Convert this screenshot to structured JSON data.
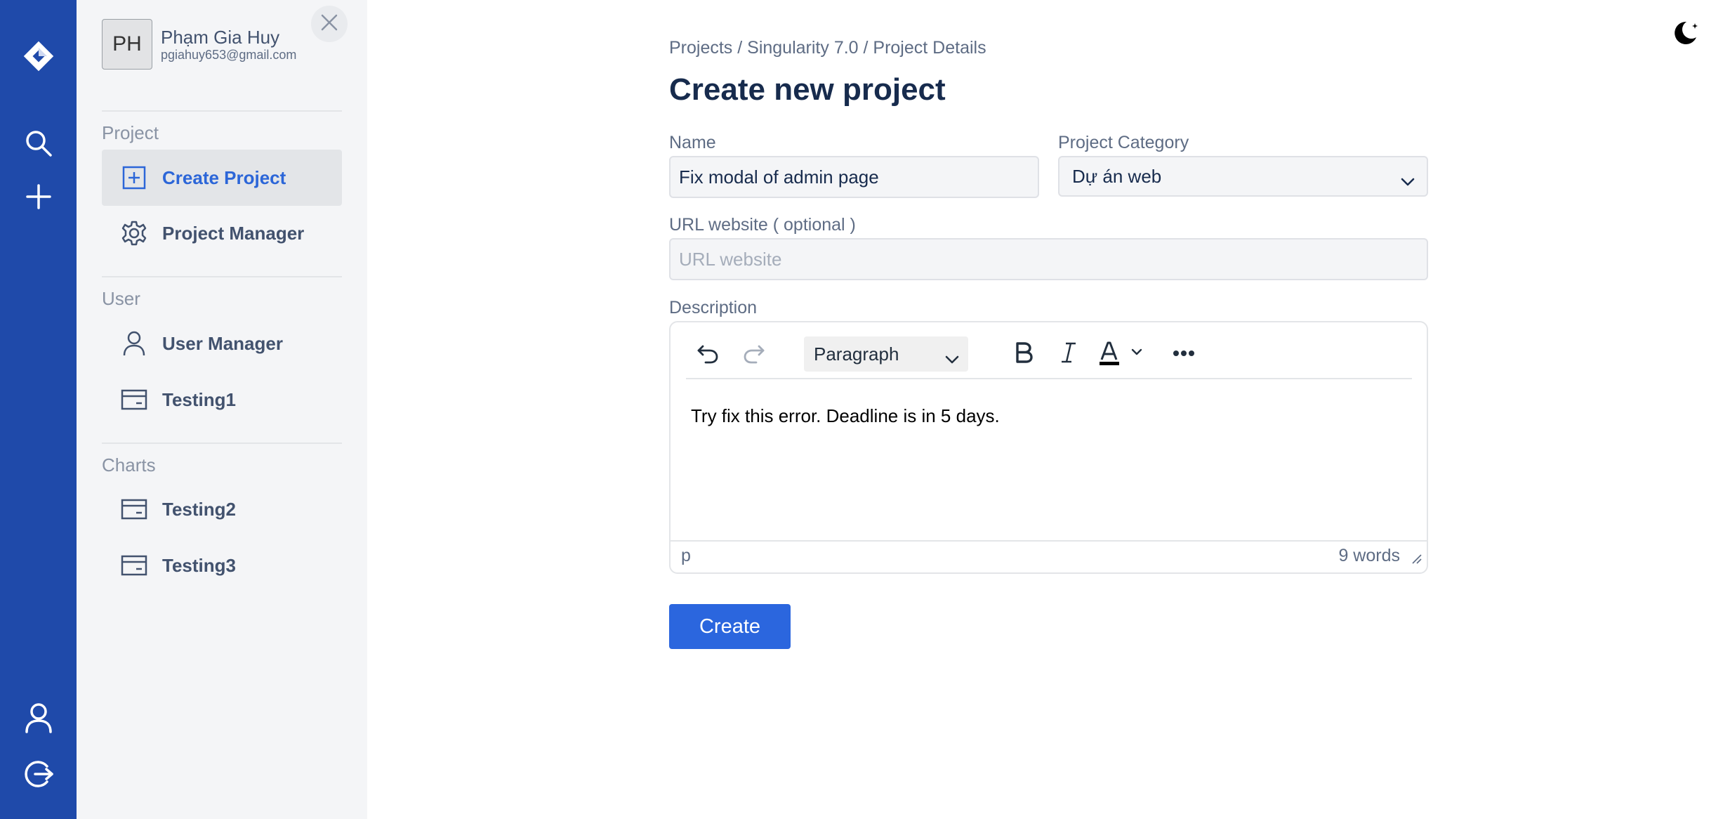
{
  "rail": {
    "icons": [
      "jira-logo-icon",
      "search-icon",
      "plus-icon",
      "user-icon",
      "logout-icon"
    ]
  },
  "profile": {
    "initials": "PH",
    "name": "Phạm Gia Huy",
    "email": "pgiahuy653@gmail.com"
  },
  "sidebar": {
    "sections": [
      {
        "title": "Project",
        "items": [
          {
            "label": "Create Project",
            "icon": "plus-square-icon",
            "active": true
          },
          {
            "label": "Project Manager",
            "icon": "gear-icon",
            "active": false
          }
        ]
      },
      {
        "title": "User",
        "items": [
          {
            "label": "User Manager",
            "icon": "user-icon",
            "active": false
          },
          {
            "label": "Testing1",
            "icon": "card-icon",
            "active": false
          }
        ]
      },
      {
        "title": "Charts",
        "items": [
          {
            "label": "Testing2",
            "icon": "card-icon",
            "active": false
          },
          {
            "label": "Testing3",
            "icon": "card-icon",
            "active": false
          }
        ]
      }
    ]
  },
  "main": {
    "breadcrumb": "Projects / Singularity 7.0 / Project Details",
    "title": "Create new project",
    "name_label": "Name",
    "name_value": "Fix modal of admin page",
    "category_label": "Project Category",
    "category_value": "Dự án web",
    "url_label": "URL website ( optional )",
    "url_placeholder": "URL website",
    "url_value": "",
    "description_label": "Description",
    "editor": {
      "block_format": "Paragraph",
      "content": "Try fix this error. Deadline is in 5 days.",
      "path": "p",
      "word_count": "9 words"
    },
    "create_label": "Create"
  },
  "colors": {
    "rail": "#1f4aaa",
    "sidebar": "#f4f5f7",
    "accent": "#2b66de",
    "active_text": "#2c66d8"
  }
}
